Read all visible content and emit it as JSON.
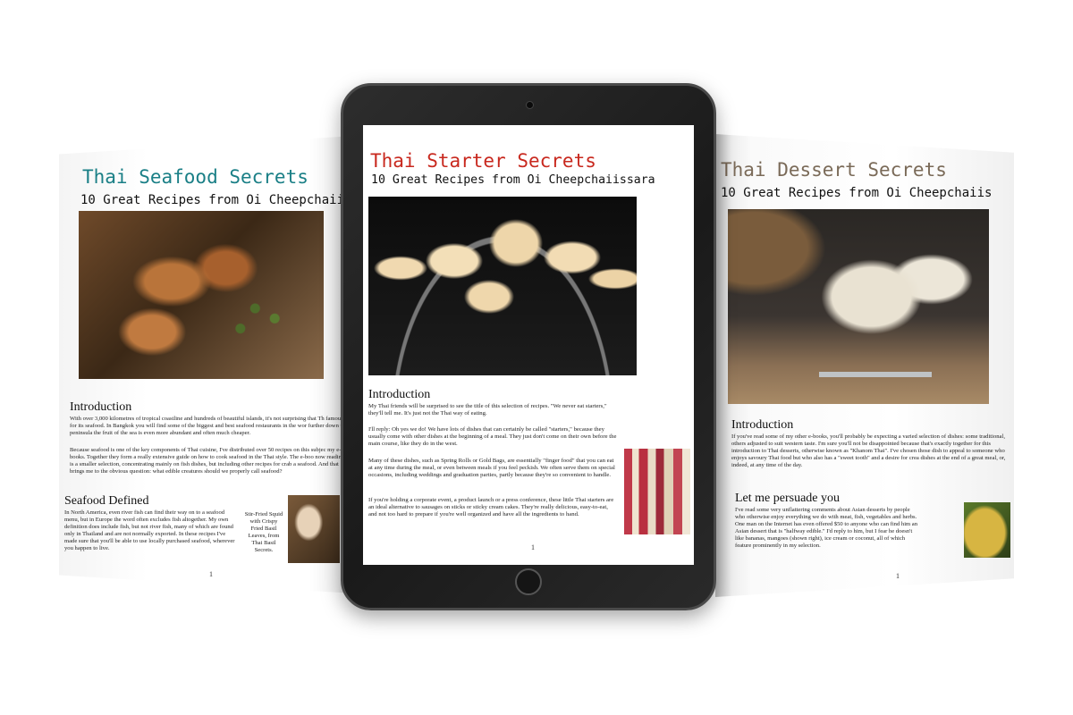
{
  "left_book": {
    "title": "Thai Seafood Secrets",
    "subtitle": "10 Great Recipes from Oi Cheepchaiis",
    "intro_heading": "Introduction",
    "intro_text": "With over 3,000 kilometres of tropical coastline and hundreds of beautiful islands, it's not surprising that Th famous for its seafood. In Bangkok you will find some of the biggest and best seafood restaurants in the wor further down the peninsula the fruit of the sea is even more abundant and often much cheaper.",
    "intro_text_2": "Because seafood is one of the key components of Thai cuisine, I've distributed over 50 recipes on this subjec my e-books. Together they form a really extensive guide on how to cook seafood in the Thai style. The e-boo now reading is a smaller selection, concentrating mainly on fish dishes, but including other recipes for crab a seafood. And that brings me to the obvious question: what edible creatures should we properly call seafood?",
    "section_heading": "Seafood Defined",
    "section_text": "In North America, even river fish can find their way on to a seafood menu, but in Europe the word often excludes fish altogether. My own definition does include fish, but not river fish, many of which are found only in Thailand and are not normally exported. In these recipes I've made sure that you'll be able to use locally purchased seafood, wherever you happen to live.",
    "caption": "Stir-Fried Squid with Crispy Fried Basil Leaves, from Thai Basil Secrets.",
    "page_number": "1",
    "title_color": "#1a7f86"
  },
  "tablet": {
    "title": "Thai Starter Secrets",
    "subtitle": "10 Great Recipes from Oi Cheepchaiissara",
    "intro_heading": "Introduction",
    "para1": "My Thai friends will be surprised to see the title of this selection of recipes. \"We never eat starters,\" they'll tell me. It's just not the Thai way of eating.",
    "para2": "I'll reply: Oh yes we do! We have lots of dishes that can certainly be called \"starters,\" because they usually come with other dishes at the beginning of a meal. They just don't come on their own before the main course, like they do in the west.",
    "para3": "Many of these dishes, such as Spring Rolls or Gold Bags, are essentially \"finger food\" that you can eat at any time during the meal, or even between meals if you feel peckish. We often serve them on special occasions, including weddings and graduation parties, partly because they're so convenient to handle.",
    "para4": "If you're holding a corporate event, a product launch or a press conference, these little Thai starters are an ideal alternative to sausages on sticks or sticky cream cakes. They're really delicious, easy-to-eat, and not too hard to prepare if you're well organized and have all the ingredients to hand.",
    "page_number": "1",
    "title_color": "#c8281e"
  },
  "right_book": {
    "title": "Thai Dessert Secrets",
    "subtitle": "10 Great Recipes from Oi Cheepchaiis",
    "intro_heading": "Introduction",
    "intro_text": "If you've read some of my other e-books, you'll probably be expecting a varied selection of dishes: some traditional, others adjusted to suit western taste. I'm sure you'll not be disappointed because that's exactly together for this introduction to Thai desserts, otherwise known as \"Khanom Thai\". I've chosen those dish to appeal to someone who enjoys savoury Thai food but who also has a \"sweet tooth\" and a desire for crea dishes at the end of a great meal, or, indeed, at any time of the day.",
    "section_heading": "Let me persuade you",
    "section_text": "I've read some very unflattering comments about Asian desserts by people who otherwise enjoy everything we do with meat, fish, vegetables and herbs. One man on the Internet has even offered $50 to anyone who can find him an Asian dessert that is \"halfway edible.\" I'd reply to him, but I fear he doesn't like bananas, mangoes (shown right), ice cream or coconut, all of which feature prominently in my selection.",
    "page_number": "1",
    "title_color": "#7a6a58"
  }
}
